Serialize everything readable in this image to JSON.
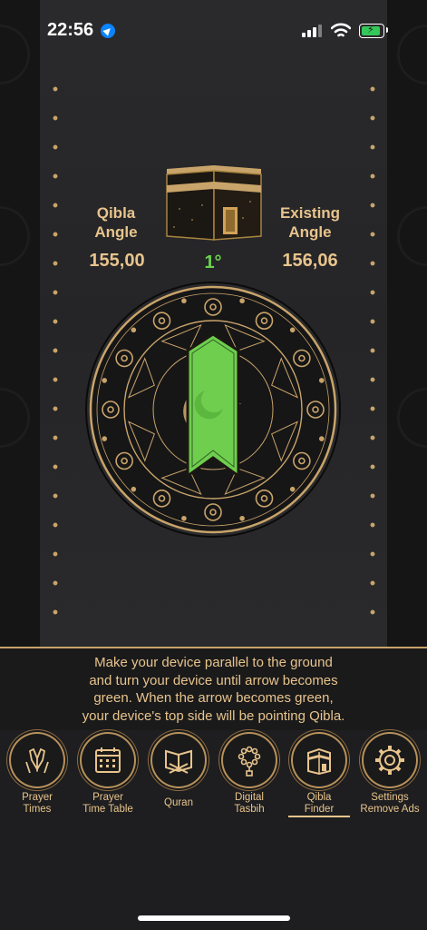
{
  "status_bar": {
    "time": "22:56"
  },
  "qibla": {
    "qibla_angle_label_1": "Qibla",
    "qibla_angle_label_2": "Angle",
    "qibla_angle_value": "155,00",
    "existing_angle_label_1": "Existing",
    "existing_angle_label_2": "Angle",
    "existing_angle_value": "156,06",
    "difference": "1°",
    "arrow_state": "green"
  },
  "instructions": {
    "line1": "Make your device parallel to the ground",
    "line2": "and turn your device until arrow becomes",
    "line3": "green. When the arrow becomes green,",
    "line4": "your device's top side will be pointing Qibla."
  },
  "nav": {
    "active": "qibla-finder",
    "items": [
      {
        "id": "prayer-times",
        "label1": "Prayer",
        "label2": "Times",
        "icon": "praying-hands-icon"
      },
      {
        "id": "prayer-time-table",
        "label1": "Prayer",
        "label2": "Time Table",
        "icon": "calendar-icon"
      },
      {
        "id": "quran",
        "label1": "Quran",
        "label2": "",
        "icon": "quran-book-icon"
      },
      {
        "id": "digital-tasbih",
        "label1": "Digital",
        "label2": "Tasbih",
        "icon": "tasbih-beads-icon"
      },
      {
        "id": "qibla-finder",
        "label1": "Qibla",
        "label2": "Finder",
        "icon": "kaaba-icon"
      },
      {
        "id": "settings",
        "label1": "Settings",
        "label2": "Remove Ads",
        "icon": "gear-icon"
      }
    ]
  },
  "colors": {
    "gold": "#e8c48c",
    "green": "#6ad34b",
    "panel": "#2a2a2c"
  }
}
